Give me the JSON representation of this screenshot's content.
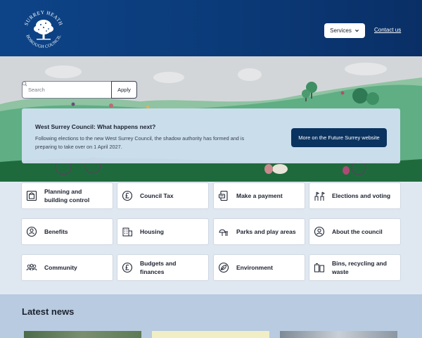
{
  "header": {
    "logo_text_top": "SURREY HEATH",
    "logo_text_bottom": "BOROUGH COUNCIL",
    "services_label": "Services",
    "contact_label": "Contact us",
    "colors": {
      "bar": "#0b3a78"
    }
  },
  "search": {
    "placeholder": "Search",
    "apply_label": "Apply"
  },
  "notice": {
    "title": "West Surrey Council: What happens next?",
    "text": "Following elections to the new West Surrey Council, the shadow authority has formed and is preparing to take over on 1 April 2027.",
    "button_label": "More on the Future Surrey website",
    "button_color": "#0b3360"
  },
  "tiles": [
    {
      "label": "Planning and building control",
      "icon": "building-plan-icon"
    },
    {
      "label": "Council Tax",
      "icon": "pound-coin-icon"
    },
    {
      "label": "Make a payment",
      "icon": "payment-card-icon"
    },
    {
      "label": "Elections and voting",
      "icon": "ballot-icon"
    },
    {
      "label": "Benefits",
      "icon": "benefits-icon"
    },
    {
      "label": "Housing",
      "icon": "housing-icon"
    },
    {
      "label": "Parks and play areas",
      "icon": "tree-icon"
    },
    {
      "label": "About the council",
      "icon": "person-icon"
    },
    {
      "label": "Community",
      "icon": "community-icon"
    },
    {
      "label": "Budgets and finances",
      "icon": "pound-sign-icon"
    },
    {
      "label": "Environment",
      "icon": "leaf-icon"
    },
    {
      "label": "Bins, recycling and waste",
      "icon": "bin-icon"
    }
  ],
  "news": {
    "title": "Latest news"
  }
}
